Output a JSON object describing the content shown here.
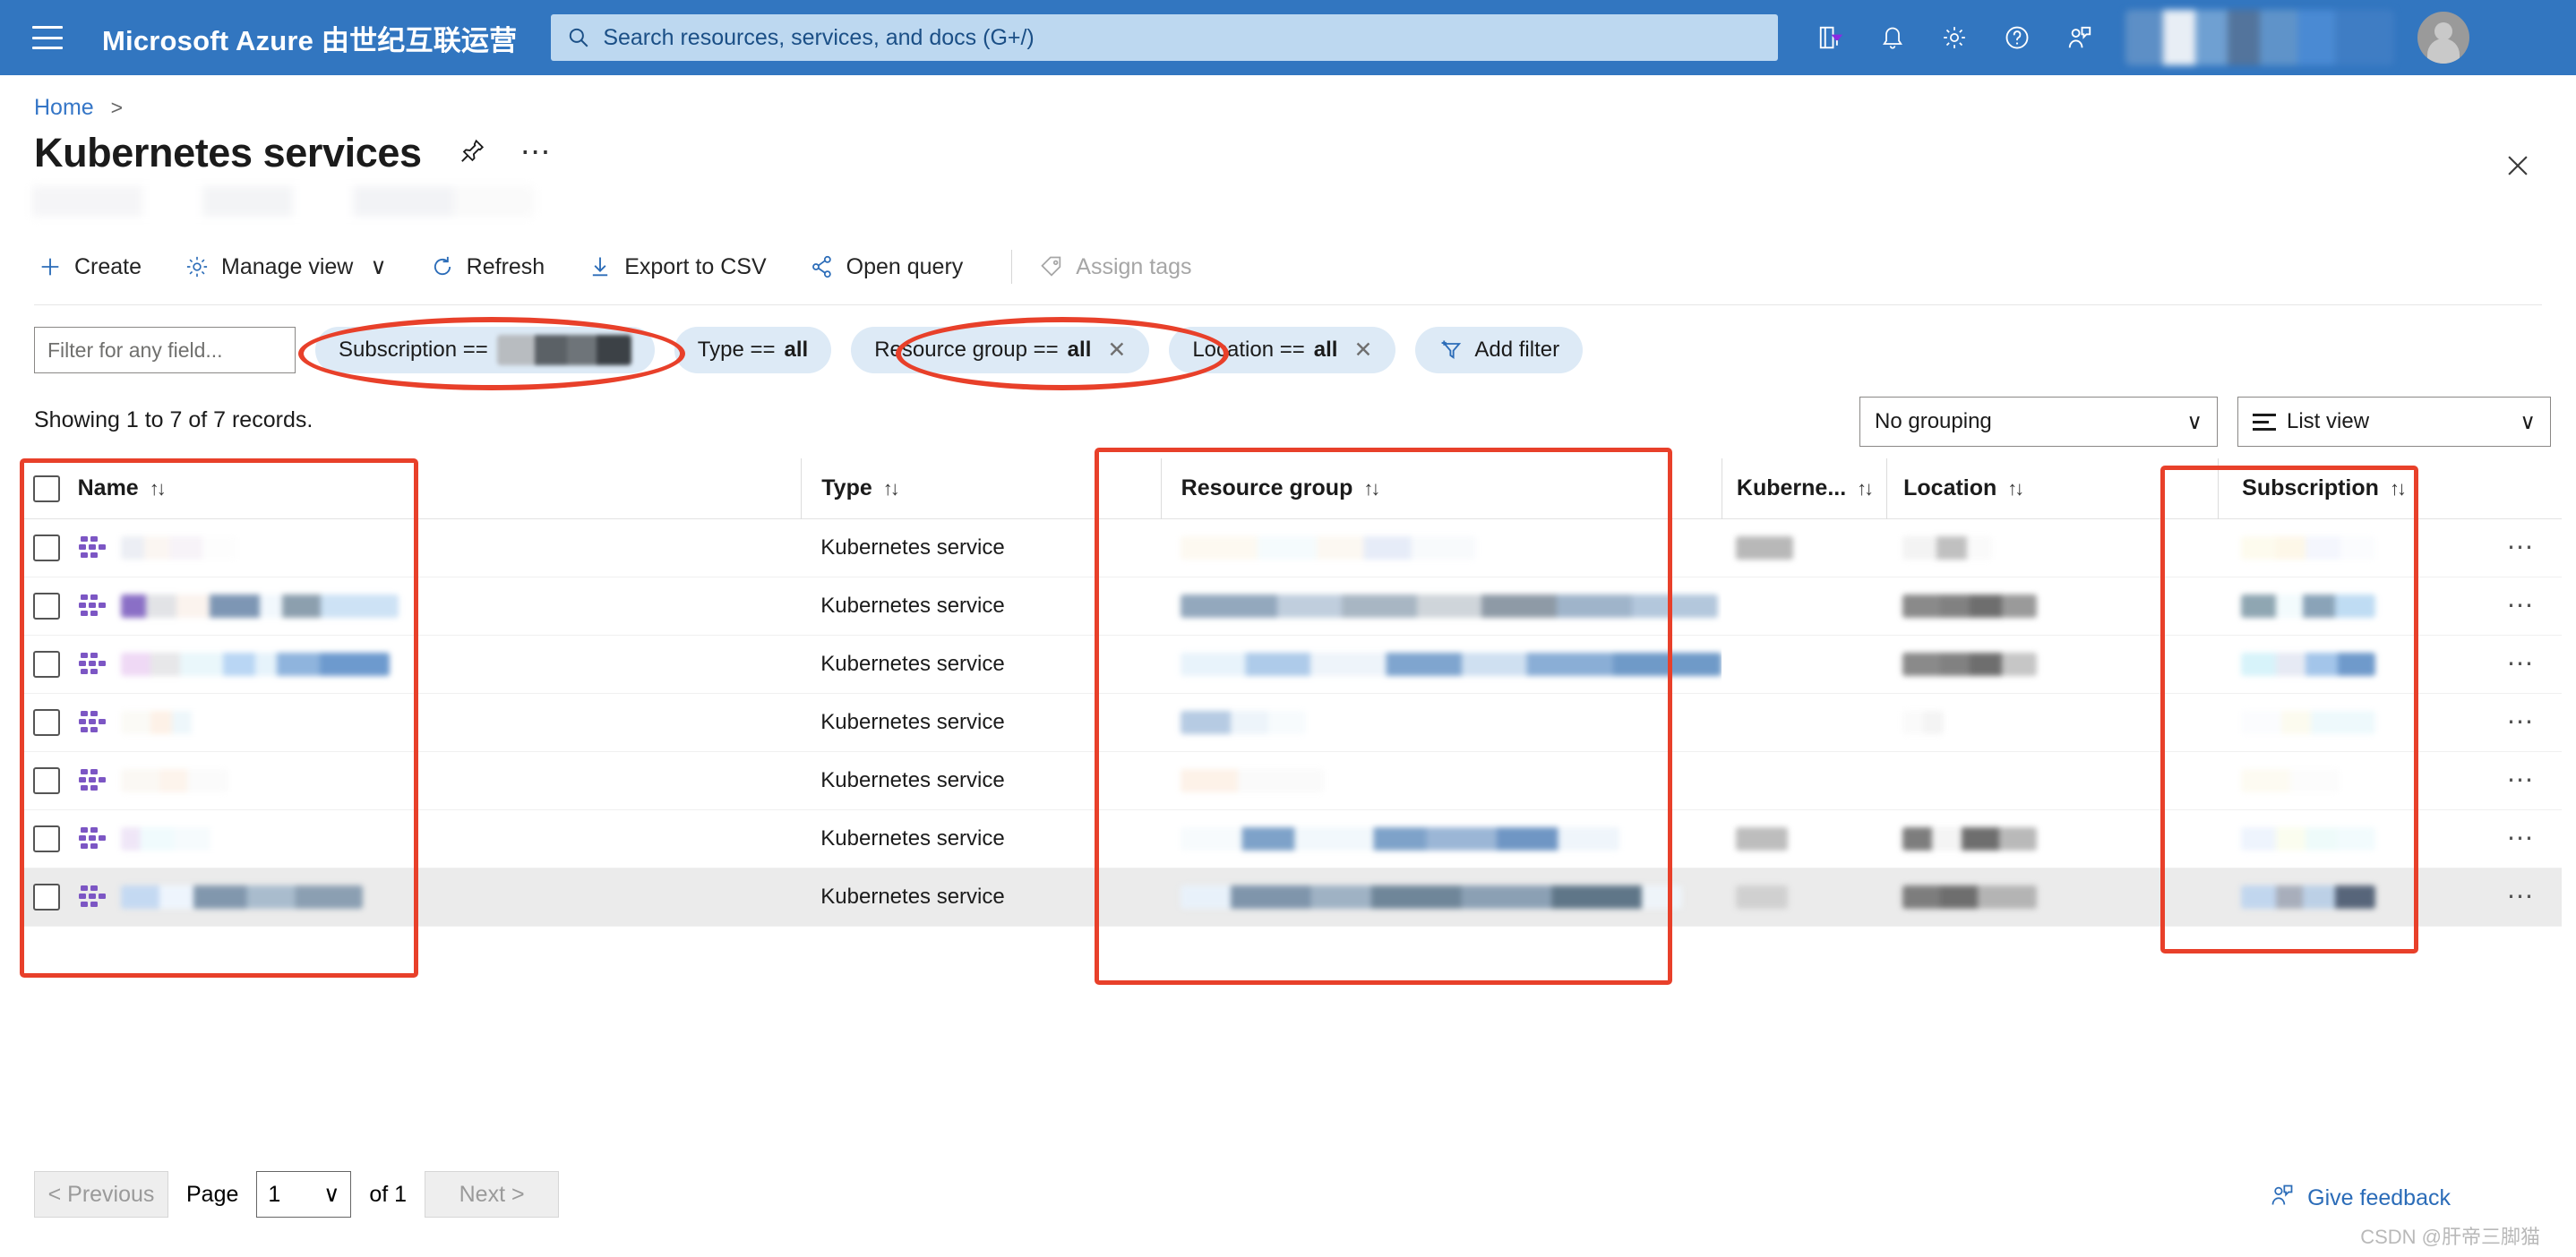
{
  "topbar": {
    "menu_icon": "hamburger-icon",
    "brand": "Microsoft Azure 由世纪互联运营",
    "search": {
      "placeholder": "Search resources, services, and docs (G+/)",
      "value": "",
      "icon": "search-icon"
    },
    "icons": [
      {
        "name": "cloud-shell-icon",
        "label": "Cloud Shell"
      },
      {
        "name": "bell-icon",
        "label": "Notifications"
      },
      {
        "name": "gear-icon",
        "label": "Settings"
      },
      {
        "name": "question-icon",
        "label": "Help"
      },
      {
        "name": "feedback-person-icon",
        "label": "Feedback"
      }
    ],
    "account_redacted": true,
    "avatar": "avatar"
  },
  "breadcrumb": {
    "home": "Home",
    "separator": ">"
  },
  "page": {
    "title": "Kubernetes services",
    "pin_icon": "pin-icon",
    "more_icon": "ellipsis-icon",
    "close_icon": "close-icon"
  },
  "toolbar": {
    "create": "Create",
    "manage_view": "Manage view",
    "manage_view_chevron": "∨",
    "refresh": "Refresh",
    "export_csv": "Export to CSV",
    "open_query": "Open query",
    "assign_tags": "Assign tags",
    "assign_tags_disabled": true
  },
  "filters": {
    "input_placeholder": "Filter for any field...",
    "input_value": "",
    "pills": [
      {
        "label": "Subscription ==",
        "value": "",
        "redacted": true,
        "closable": false,
        "annotated": true
      },
      {
        "label": "Type ==",
        "value": "all",
        "redacted": false,
        "closable": false,
        "annotated": false
      },
      {
        "label": "Resource group ==",
        "value": "all",
        "redacted": false,
        "closable": true,
        "annotated": true
      },
      {
        "label": "Location ==",
        "value": "all",
        "redacted": false,
        "closable": true,
        "annotated": false
      }
    ],
    "add_filter": "Add filter",
    "add_filter_icon": "add-filter-icon"
  },
  "results": {
    "records_text": "Showing 1 to 7 of 7 records.",
    "grouping": "No grouping",
    "grouping_chevron": "∨",
    "view": "List view",
    "view_chevron": "∨",
    "view_icon": "list-view-icon"
  },
  "table": {
    "sort_icon": "↑↓",
    "columns": [
      {
        "key": "name",
        "label": "Name",
        "sortable": true
      },
      {
        "key": "type",
        "label": "Type",
        "sortable": true
      },
      {
        "key": "resource_group",
        "label": "Resource group",
        "sortable": true
      },
      {
        "key": "kubernetes_version",
        "label": "Kuberne...",
        "sortable": true
      },
      {
        "key": "location",
        "label": "Location",
        "sortable": true
      },
      {
        "key": "subscription",
        "label": "Subscription",
        "sortable": true
      }
    ],
    "row_menu_icon": "ellipsis-icon",
    "row_icon": "aks-cluster-icon",
    "rows": [
      {
        "name": "",
        "type": "Kubernetes service",
        "resource_group": "",
        "kubernetes_version": "",
        "location": "",
        "subscription": "",
        "selected": false,
        "redacted": true
      },
      {
        "name": "",
        "type": "Kubernetes service",
        "resource_group": "",
        "kubernetes_version": "",
        "location": "",
        "subscription": "",
        "selected": false,
        "redacted": true
      },
      {
        "name": "",
        "type": "Kubernetes service",
        "resource_group": "",
        "kubernetes_version": "",
        "location": "",
        "subscription": "",
        "selected": false,
        "redacted": true
      },
      {
        "name": "",
        "type": "Kubernetes service",
        "resource_group": "",
        "kubernetes_version": "",
        "location": "",
        "subscription": "",
        "selected": false,
        "redacted": true
      },
      {
        "name": "",
        "type": "Kubernetes service",
        "resource_group": "",
        "kubernetes_version": "",
        "location": "",
        "subscription": "",
        "selected": false,
        "redacted": true
      },
      {
        "name": "",
        "type": "Kubernetes service",
        "resource_group": "",
        "kubernetes_version": "",
        "location": "",
        "subscription": "",
        "selected": false,
        "redacted": true
      },
      {
        "name": "",
        "type": "Kubernetes service",
        "resource_group": "",
        "kubernetes_version": "",
        "location": "",
        "subscription": "",
        "selected": true,
        "redacted": true
      }
    ]
  },
  "pagination": {
    "previous": "< Previous",
    "previous_disabled": true,
    "page_label": "Page",
    "page_value": "1",
    "page_chevron": "∨",
    "of_label": "of 1",
    "next": "Next >",
    "next_disabled": true
  },
  "footer": {
    "give_feedback": "Give feedback",
    "feedback_icon": "feedback-person-icon",
    "watermark": "CSDN @肝帝三脚猫"
  },
  "annotations": {
    "color": "#e8402a",
    "shapes": [
      {
        "type": "ellipse",
        "target": "subscription-filter-pill"
      },
      {
        "type": "ellipse",
        "target": "resource-group-filter-pill"
      },
      {
        "type": "rect",
        "target": "name-column"
      },
      {
        "type": "rect",
        "target": "resource-group-column"
      },
      {
        "type": "rect",
        "target": "subscription-column"
      }
    ]
  },
  "colors": {
    "azure_blue": "#3276c0",
    "link_blue": "#3576c7",
    "pill_bg": "#ddeaf6",
    "annotation_red": "#e8402a",
    "aks_purple": "#7c56c4"
  }
}
